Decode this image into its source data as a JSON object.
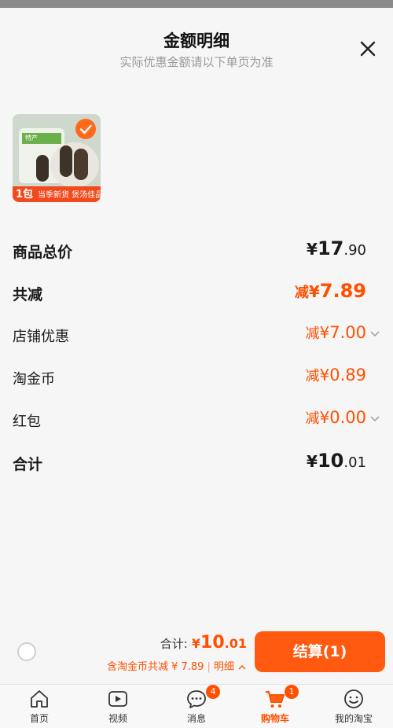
{
  "sheet": {
    "title": "金额明细",
    "subtitle": "实际优惠金额请以下单页为准"
  },
  "product": {
    "pack_label": "1包",
    "promo_text": "当季新货 煲汤佳品",
    "bag_label": "特产"
  },
  "breakdown": {
    "items": [
      {
        "label": "商品总价",
        "prefix": "",
        "currency": "¥",
        "int": "17",
        "dec": ".90"
      },
      {
        "label": "共减",
        "prefix": "减",
        "currency": "¥",
        "int": "7",
        "dec": ".89"
      },
      {
        "label": "店铺优惠",
        "prefix": "减",
        "currency": "¥",
        "int": "7",
        "dec": ".00"
      },
      {
        "label": "淘金币",
        "prefix": "减",
        "currency": "¥",
        "int": "0",
        "dec": ".89"
      },
      {
        "label": "红包",
        "prefix": "减",
        "currency": "¥",
        "int": "0",
        "dec": ".00"
      },
      {
        "label": "合计",
        "prefix": "",
        "currency": "¥",
        "int": "10",
        "dec": ".01"
      }
    ]
  },
  "checkout": {
    "total_label": "合计:",
    "total_currency": "¥",
    "total_int": "10",
    "total_dec": ".01",
    "discount_text": "含淘金币共减 ¥ 7.89",
    "detail_text": "明细",
    "pay_button": "结算(1)"
  },
  "tabbar": {
    "tabs": [
      {
        "label": "首页",
        "icon": "home-icon"
      },
      {
        "label": "视频",
        "icon": "video-icon"
      },
      {
        "label": "消息",
        "icon": "message-icon",
        "badge": "4"
      },
      {
        "label": "购物车",
        "icon": "cart-icon",
        "badge": "1",
        "active": true
      },
      {
        "label": "我的淘宝",
        "icon": "profile-icon"
      }
    ]
  },
  "colors": {
    "accent": "#ff5000",
    "button": "#ff5a10"
  }
}
